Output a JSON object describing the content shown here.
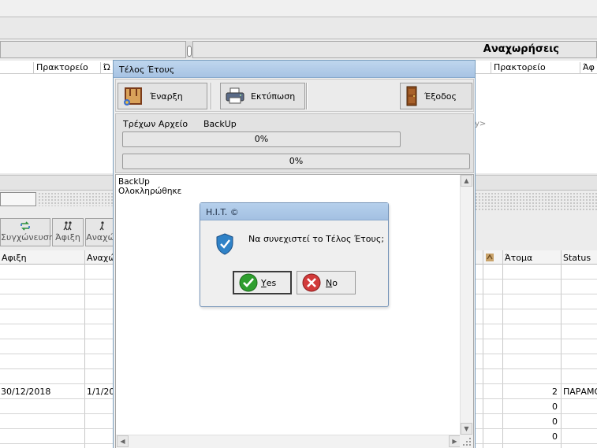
{
  "background": {
    "right_panel_title": "Αναχωρήσεις",
    "left_col_headers": [
      "Πρακτορείο",
      "Ώ"
    ],
    "right_col_headers": [
      "Πρακτορείο",
      "Άφ"
    ],
    "right_hint": "y>",
    "toolbar": {
      "merge_label": "Συγχώνευση",
      "arrival_label": "Άφιξη",
      "departure_label": "Αναχώ"
    },
    "grid_left": {
      "headers": [
        "Αφιξη",
        "Αναχώ"
      ],
      "row_values": {
        "arrival": "30/12/2018",
        "departure": "1/1/20"
      }
    },
    "grid_right": {
      "headers": [
        "Άτομα",
        "Status"
      ],
      "rows": [
        {
          "persons": "2",
          "status": "ΠΑΡΑΜΟ"
        },
        {
          "persons": "0",
          "status": ""
        },
        {
          "persons": "0",
          "status": ""
        },
        {
          "persons": "0",
          "status": ""
        }
      ]
    }
  },
  "window": {
    "title": "Τέλος Έτους",
    "start_label": "Έναρξη",
    "print_label": "Εκτύπωση",
    "exit_label": "Έξοδος",
    "current_file_label": "Τρέχων Αρχείο",
    "backup_label": "BackUp",
    "progress1_text": "0%",
    "progress2_text": "0%",
    "progress1_value": 0,
    "progress2_value": 0,
    "log_lines": [
      "BackUp",
      "Ολοκληρώθηκε"
    ]
  },
  "dialog": {
    "title": "H.I.T. ©",
    "message": "Να συνεχιστεί το Τέλος Έτους;",
    "yes_label": "Yes",
    "no_label": "No",
    "yes_accent": "Y",
    "no_accent": "N"
  },
  "colors": {
    "title_bar": "#a7c3e3",
    "yes_icon": "#2e9e2e",
    "no_icon": "#d23a3a",
    "shield": "#2f82c7"
  }
}
